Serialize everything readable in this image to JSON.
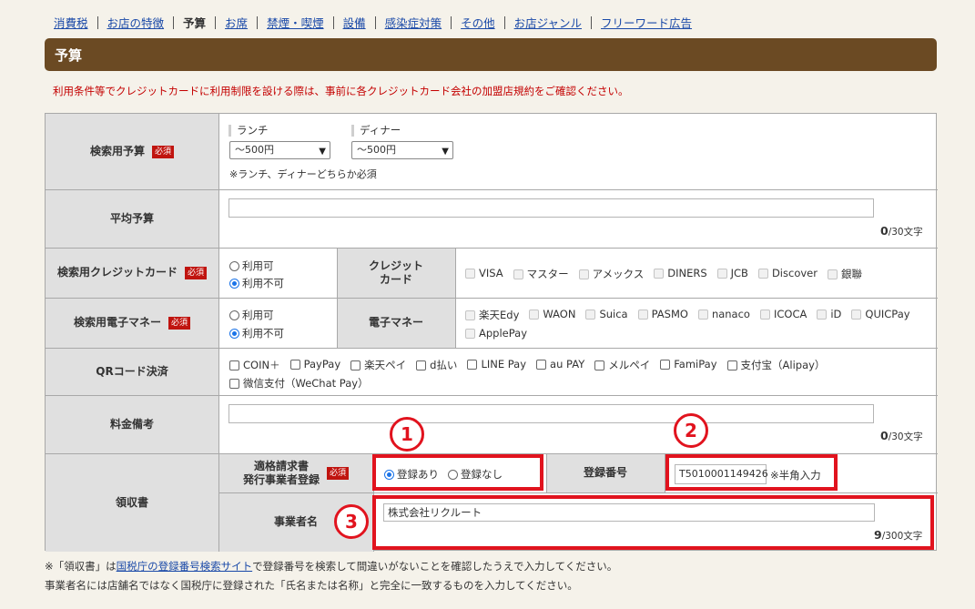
{
  "tabs": [
    "消費税",
    "お店の特徴",
    "予算",
    "お席",
    "禁煙・喫煙",
    "設備",
    "感染症対策",
    "その他",
    "お店ジャンル",
    "フリーワード広告"
  ],
  "active_tab": "予算",
  "section_title": "予算",
  "notice": "利用条件等でクレジットカードに利用制限を設ける際は、事前に各クレジットカード会社の加盟店規約をご確認ください。",
  "required_label": "必須",
  "budget": {
    "label": "検索用予算",
    "lunch_label": "ランチ",
    "lunch_value": "～500円",
    "dinner_label": "ディナー",
    "dinner_value": "～500円",
    "note": "※ランチ、ディナーどちらか必須"
  },
  "average_budget": {
    "label": "平均予算",
    "value": "",
    "count": "0",
    "max": "/30文字"
  },
  "credit_card": {
    "label": "検索用クレジットカード",
    "options": [
      "利用可",
      "利用不可"
    ],
    "selected": "利用不可",
    "sub_label": "クレジット\nカード",
    "brands": [
      "VISA",
      "マスター",
      "アメックス",
      "DINERS",
      "JCB",
      "Discover",
      "銀聯"
    ]
  },
  "e_money": {
    "label": "検索用電子マネー",
    "options": [
      "利用可",
      "利用不可"
    ],
    "selected": "利用不可",
    "sub_label": "電子マネー",
    "brands": [
      "楽天Edy",
      "WAON",
      "Suica",
      "PASMO",
      "nanaco",
      "ICOCA",
      "iD",
      "QUICPay",
      "ApplePay"
    ]
  },
  "qr": {
    "label": "QRコード決済",
    "brands": [
      "COIN＋",
      "PayPay",
      "楽天ペイ",
      "d払い",
      "LINE Pay",
      "au PAY",
      "メルペイ",
      "FamiPay",
      "支付宝（Alipay）",
      "微信支付（WeChat Pay）"
    ]
  },
  "fee_note": {
    "label": "料金備考",
    "value": "",
    "count": "0",
    "max": "/30文字"
  },
  "receipt": {
    "label": "領収書",
    "invoice_label": "適格請求書\n発行事業者登録",
    "options": [
      "登録あり",
      "登録なし"
    ],
    "selected": "登録あり",
    "reg_number_label": "登録番号",
    "reg_number_value": "T5010001149426",
    "reg_number_note": "※半角入力",
    "business_name_label": "事業者名",
    "business_name_value": "株式会社リクルート",
    "business_count": "9",
    "business_max": "/300文字"
  },
  "annotations": [
    "1",
    "2",
    "3"
  ],
  "annotation_color": "#e1131e",
  "footnote": {
    "line1_pre": "※「領収書」は",
    "line1_link": "国税庁の登録番号検索サイト",
    "line1_post": "で登録番号を検索して間違いがないことを確認したうえで入力してください。",
    "line2": "事業者名には店舗名ではなく国税庁に登録された「氏名または名称」と完全に一致するものを入力してください。"
  },
  "colors": {
    "brown_bar": "#6b4a23",
    "required_bg": "#c0140f",
    "notice_red": "#c40000",
    "link_blue": "#1a49a8"
  }
}
